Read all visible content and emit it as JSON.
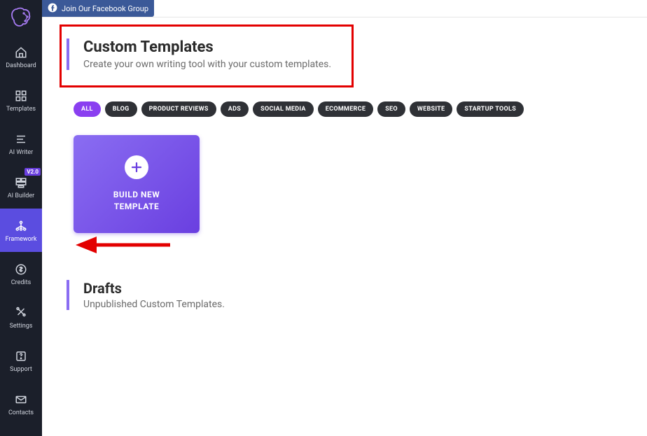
{
  "banner": {
    "text": "Join Our Facebook Group"
  },
  "sidebar": {
    "items": [
      {
        "label": "Dashboard"
      },
      {
        "label": "Templates"
      },
      {
        "label": "AI Writer"
      },
      {
        "label": "AI Builder",
        "badge": "V2.0"
      },
      {
        "label": "Framework"
      },
      {
        "label": "Credits"
      },
      {
        "label": "Settings"
      },
      {
        "label": "Support"
      },
      {
        "label": "Contacts"
      }
    ]
  },
  "page": {
    "title": "Custom Templates",
    "subtitle": "Create your own writing tool with your custom templates."
  },
  "filters": [
    "ALL",
    "BLOG",
    "PRODUCT REVIEWS",
    "ADS",
    "SOCIAL MEDIA",
    "ECOMMERCE",
    "SEO",
    "WEBSITE",
    "STARTUP TOOLS"
  ],
  "build_card": {
    "line1": "BUILD NEW",
    "line2": "TEMPLATE"
  },
  "drafts": {
    "title": "Drafts",
    "subtitle": "Unpublished Custom Templates."
  }
}
